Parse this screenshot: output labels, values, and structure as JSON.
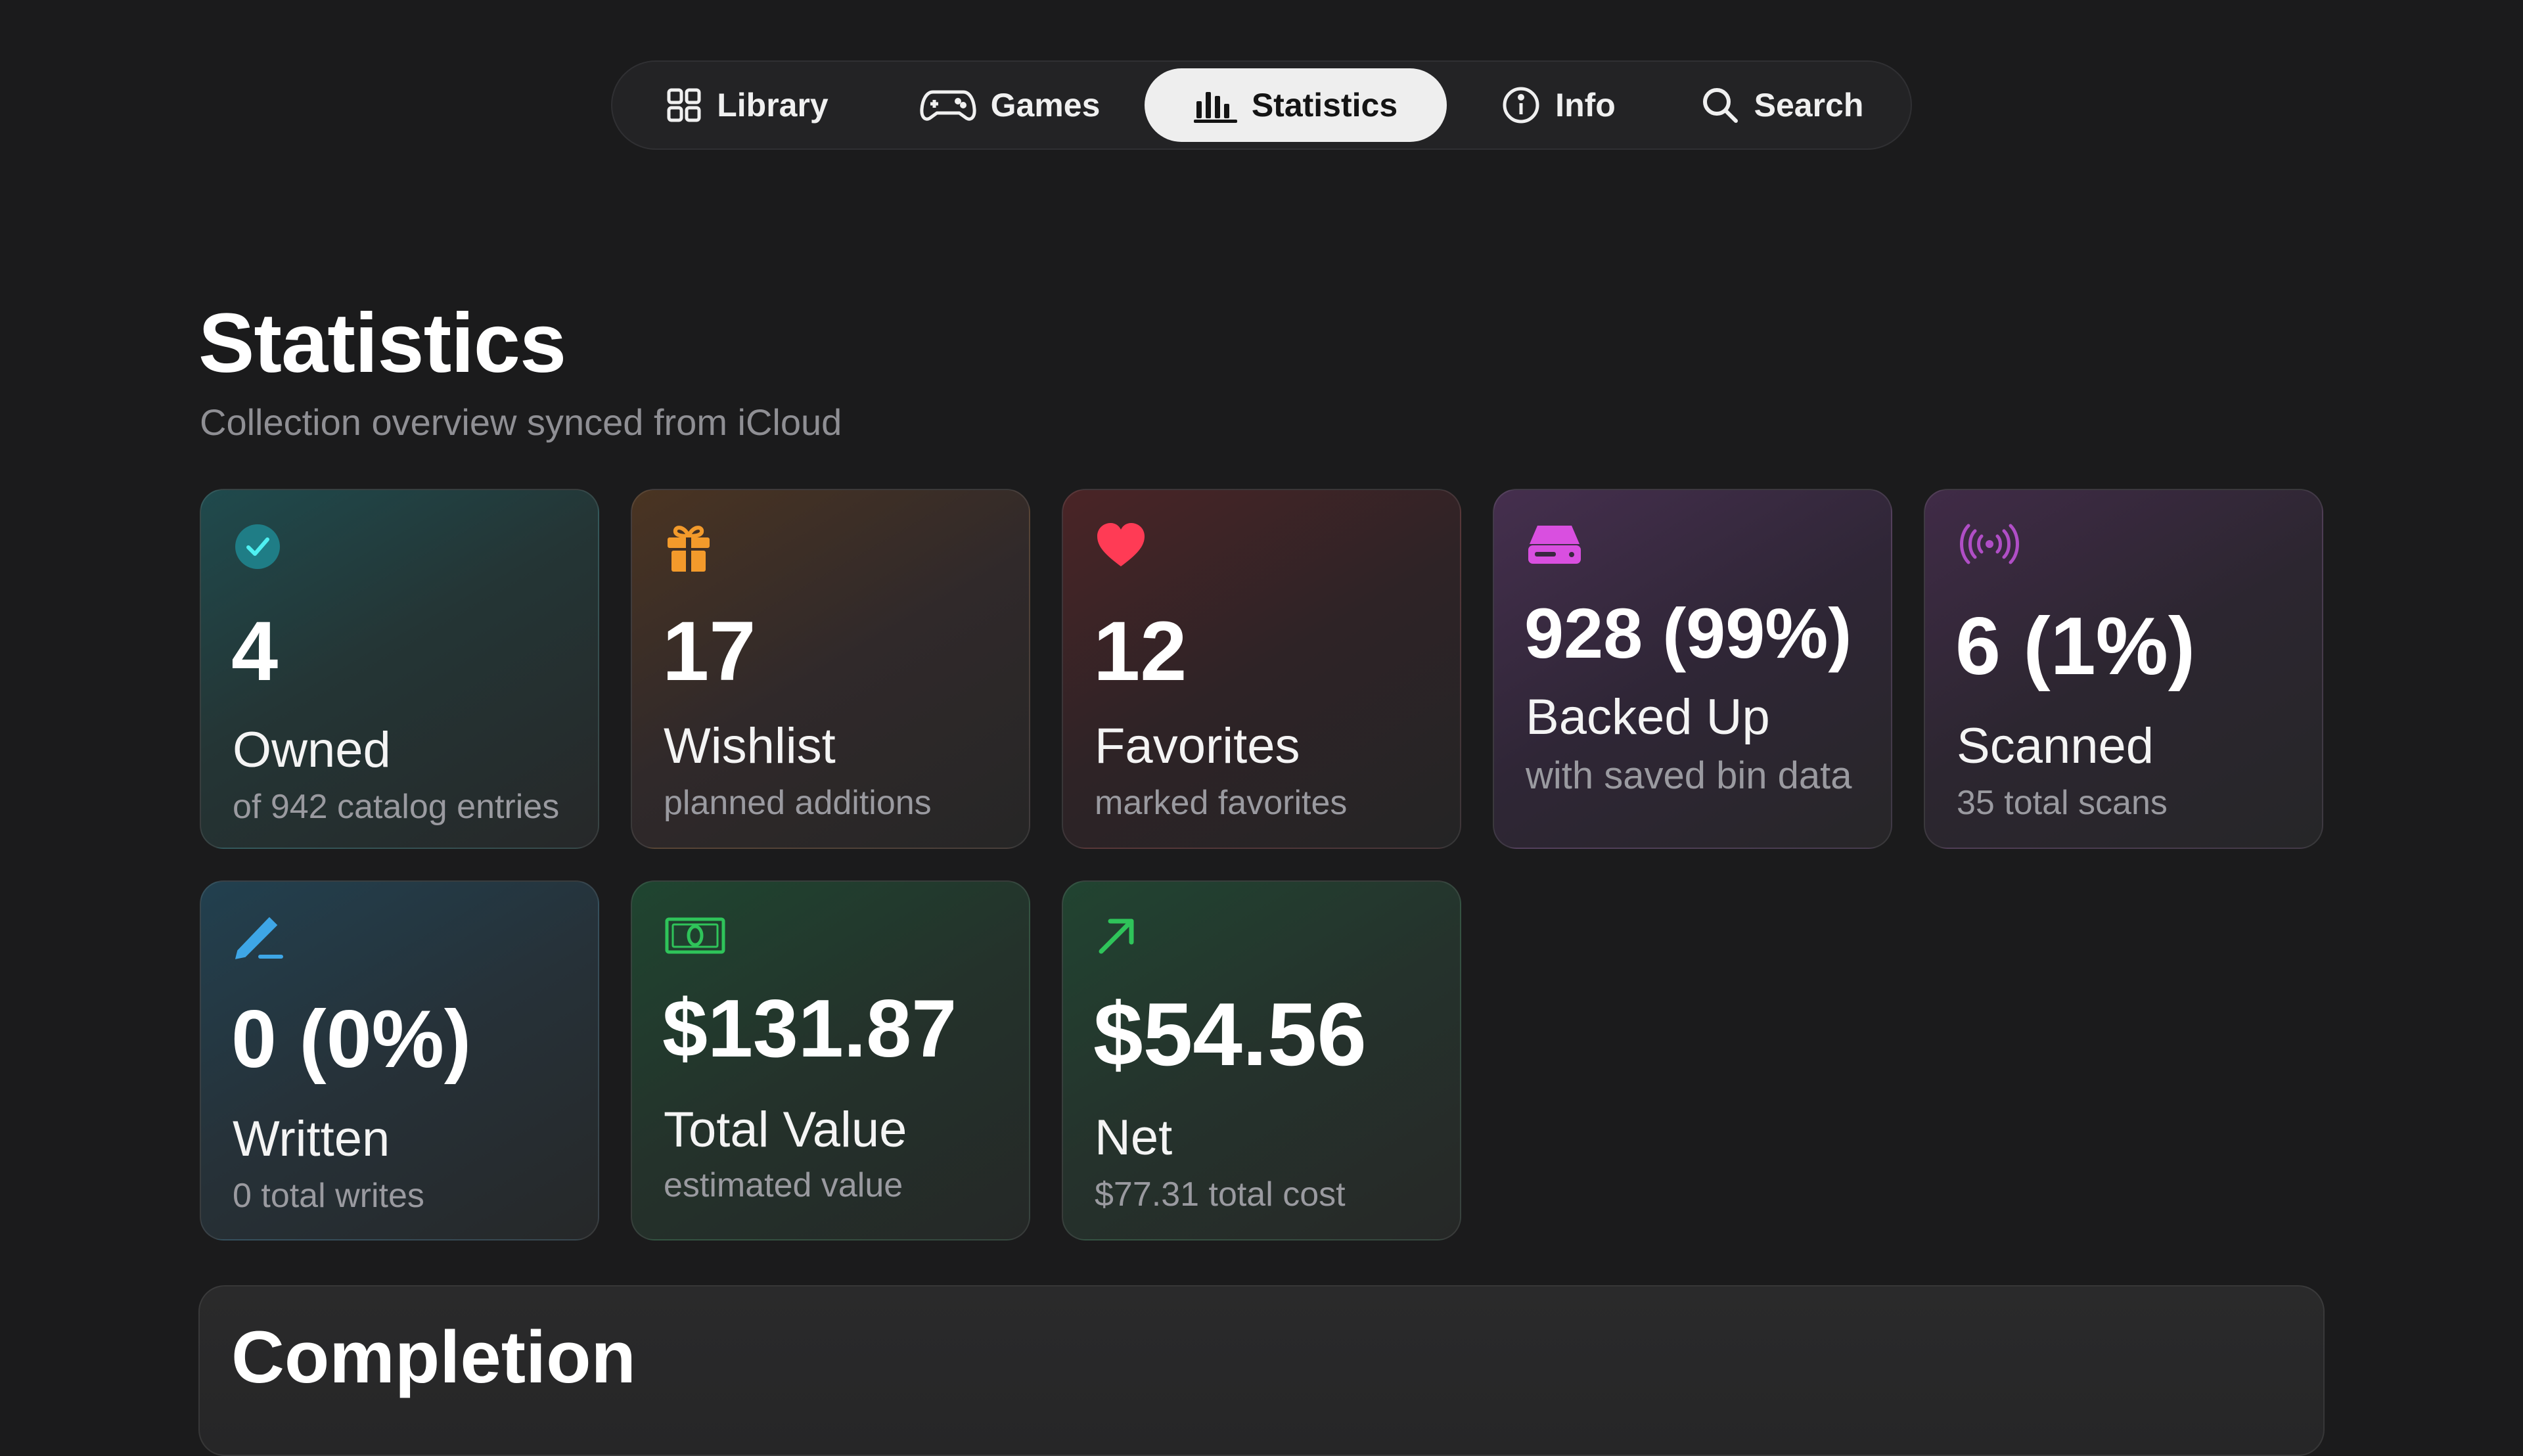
{
  "nav": {
    "items": [
      {
        "label": "Library",
        "icon": "grid-icon"
      },
      {
        "label": "Games",
        "icon": "gamepad-icon"
      },
      {
        "label": "Statistics",
        "icon": "bar-chart-icon",
        "active": true
      },
      {
        "label": "Info",
        "icon": "info-circle-icon"
      },
      {
        "label": "Search",
        "icon": "magnifier-icon"
      }
    ]
  },
  "page": {
    "title": "Statistics",
    "subtitle": "Collection overview synced from iCloud"
  },
  "cards": [
    {
      "id": "owned",
      "icon": "checkmark-circle-icon",
      "accent": "#2ec4c8",
      "value": "4",
      "label": "Owned",
      "sub": "of 942 catalog entries"
    },
    {
      "id": "wishlist",
      "icon": "gift-icon",
      "accent": "#f39a2b",
      "value": "17",
      "label": "Wishlist",
      "sub": "planned additions"
    },
    {
      "id": "favorites",
      "icon": "heart-icon",
      "accent": "#ff3b55",
      "value": "12",
      "label": "Favorites",
      "sub": "marked favorites"
    },
    {
      "id": "backed",
      "icon": "drive-icon",
      "accent": "#d94fe0",
      "value": "928 (99%)",
      "label": "Backed Up",
      "sub": "with saved bin data"
    },
    {
      "id": "scanned",
      "icon": "broadcast-icon",
      "accent": "#b04ec6",
      "value": "6 (1%)",
      "label": "Scanned",
      "sub": "35 total scans"
    },
    {
      "id": "written",
      "icon": "pencil-icon",
      "accent": "#3ea6e6",
      "value": "0 (0%)",
      "label": "Written",
      "sub": "0 total writes"
    },
    {
      "id": "total",
      "icon": "banknote-icon",
      "accent": "#2fc45a",
      "value": "$131.87",
      "label": "Total Value",
      "sub": "estimated value"
    },
    {
      "id": "net",
      "icon": "arrow-up-right-icon",
      "accent": "#2fc45a",
      "value": "$54.56",
      "label": "Net",
      "sub": "$77.31 total cost"
    }
  ],
  "completion": {
    "title": "Completion"
  },
  "colors": {
    "background": "#1b1b1c",
    "nav_active_bg": "#eeeeee"
  }
}
